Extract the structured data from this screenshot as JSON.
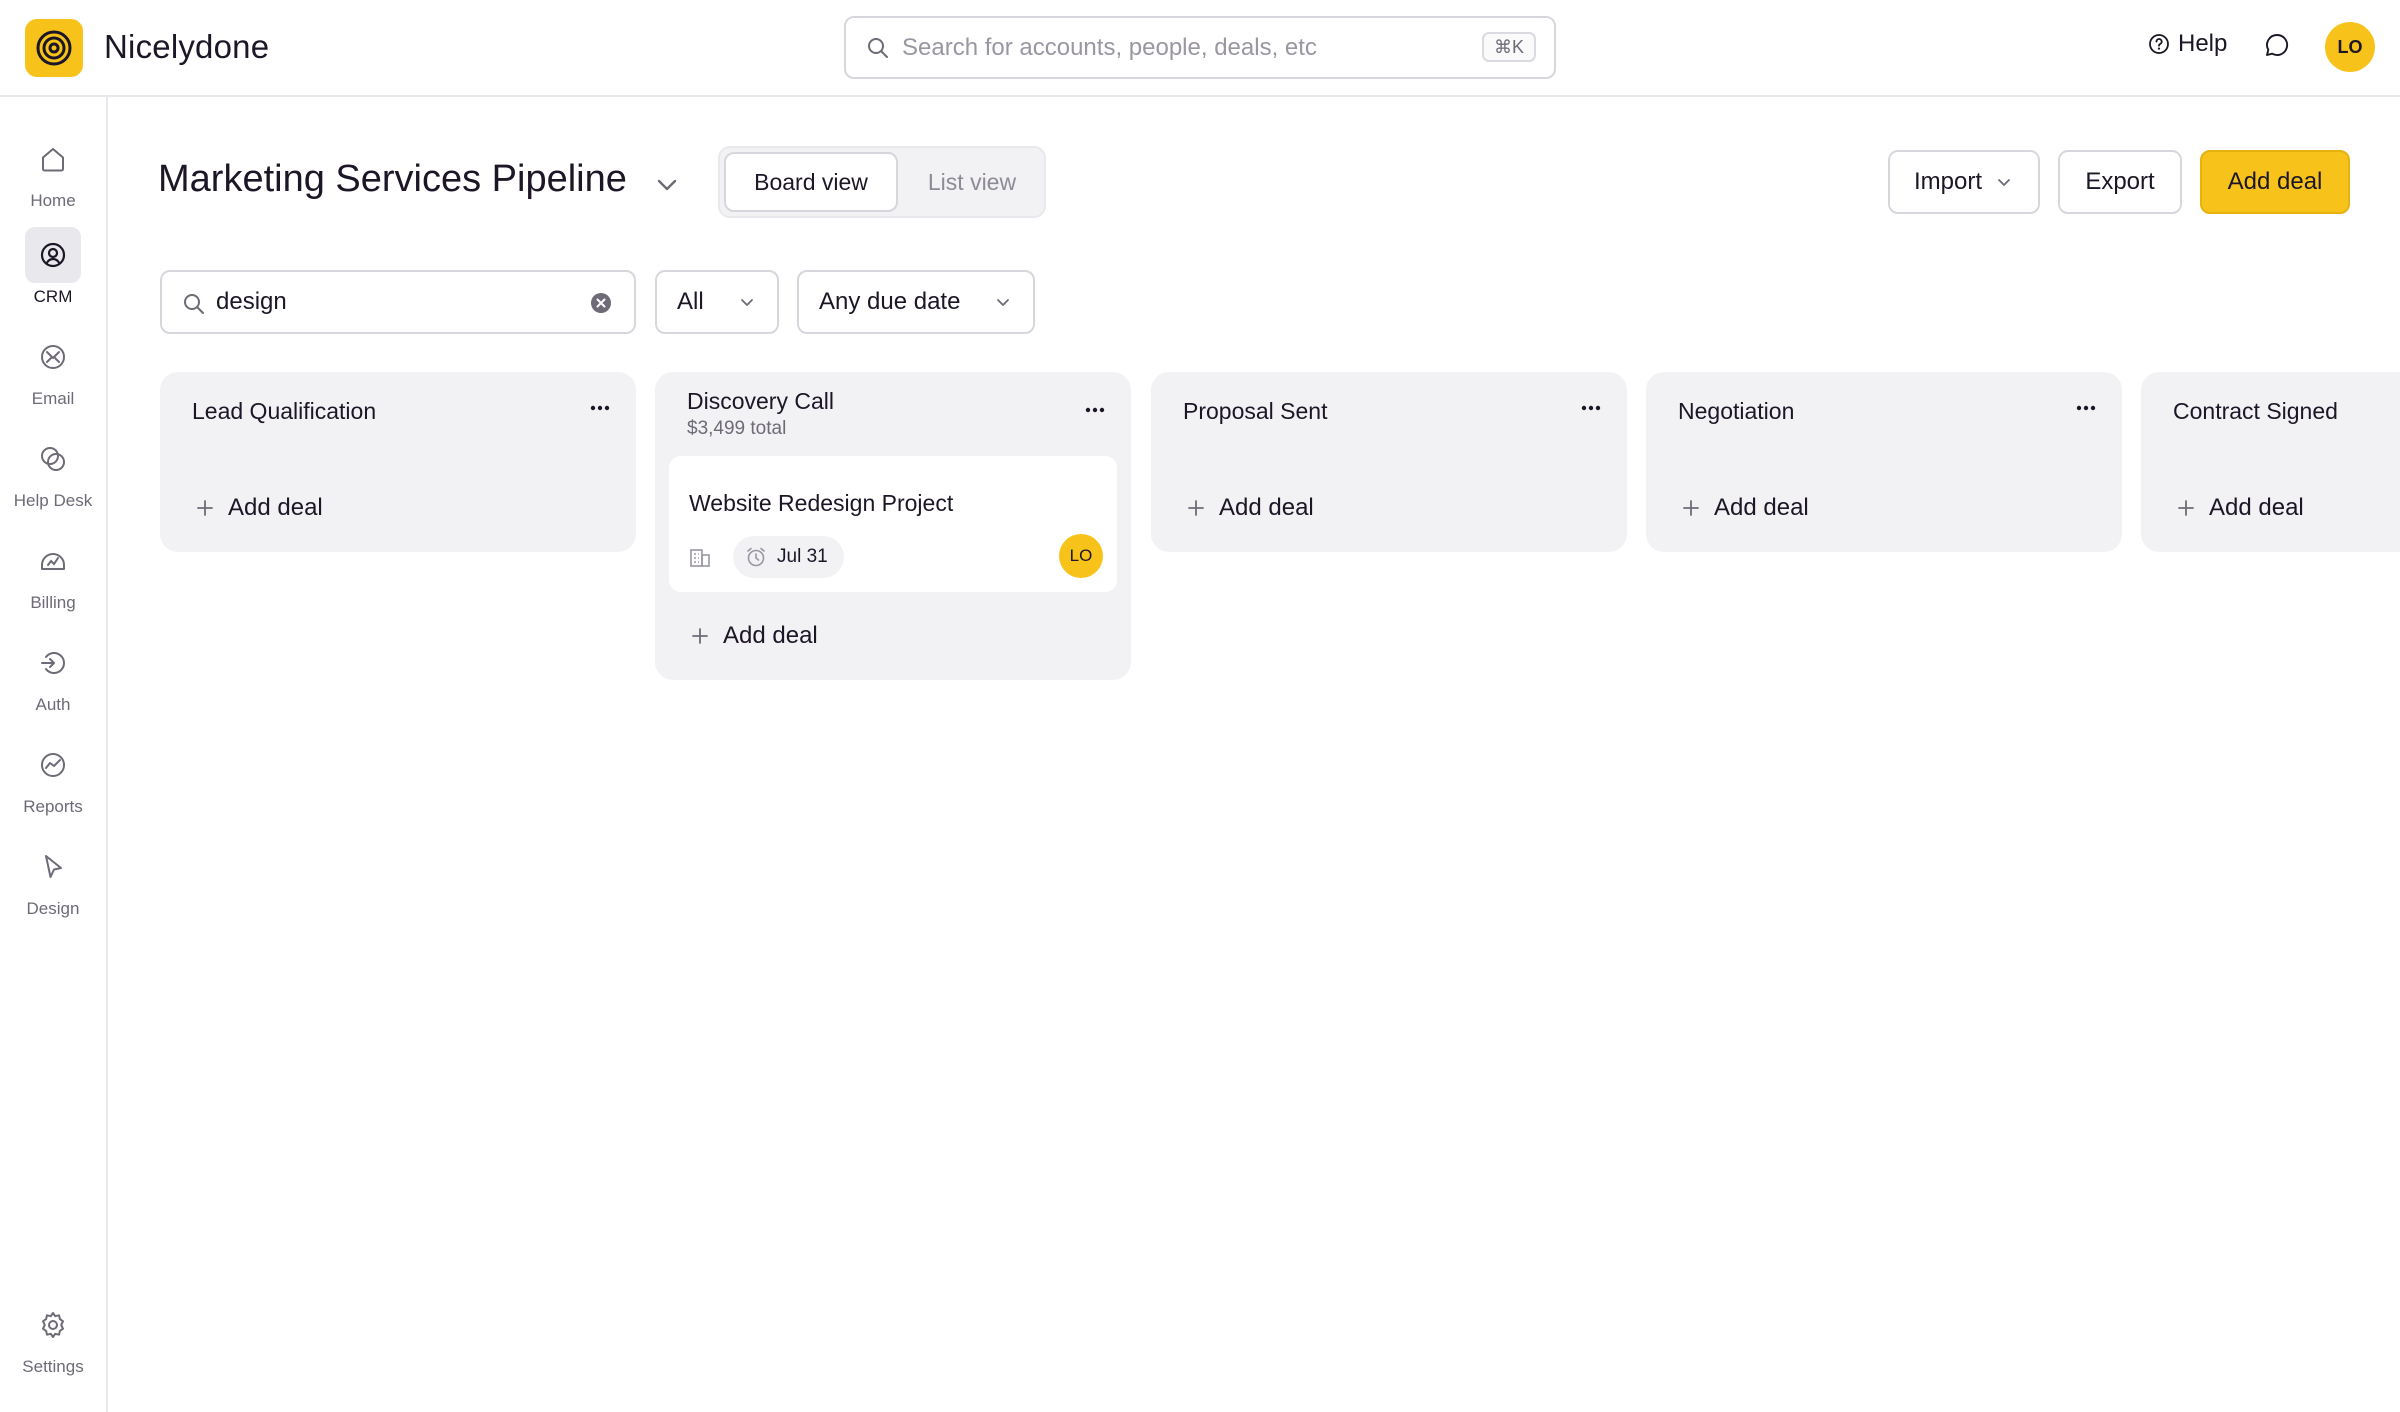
{
  "app": {
    "name": "Nicelydone",
    "search_placeholder": "Search for accounts, people, deals, etc",
    "search_shortcut": "⌘K",
    "help_label": "Help",
    "user_initials": "LO",
    "brand_color": "#f7c31b"
  },
  "sidebar": {
    "items": [
      {
        "label": "Home",
        "icon": "home-icon"
      },
      {
        "label": "CRM",
        "icon": "crm-icon",
        "active": true
      },
      {
        "label": "Email",
        "icon": "email-icon"
      },
      {
        "label": "Help Desk",
        "icon": "help-desk-icon"
      },
      {
        "label": "Billing",
        "icon": "billing-icon"
      },
      {
        "label": "Auth",
        "icon": "auth-icon"
      },
      {
        "label": "Reports",
        "icon": "reports-icon"
      },
      {
        "label": "Design",
        "icon": "design-icon"
      }
    ],
    "settings_label": "Settings"
  },
  "header": {
    "title": "Marketing Services Pipeline",
    "views": {
      "board": "Board view",
      "list": "List view",
      "active": "board"
    },
    "import_label": "Import",
    "export_label": "Export",
    "add_deal_label": "Add deal"
  },
  "filters": {
    "search_value": "design",
    "owner_filter": "All",
    "due_filter": "Any due date"
  },
  "board": {
    "add_deal_label": "Add deal",
    "columns": [
      {
        "title": "Lead Qualification",
        "total": "",
        "cards": []
      },
      {
        "title": "Discovery Call",
        "total": "$3,499 total",
        "cards": [
          {
            "title": "Website Redesign Project",
            "due": "Jul 31",
            "owner_initials": "LO"
          }
        ]
      },
      {
        "title": "Proposal Sent",
        "total": "",
        "cards": []
      },
      {
        "title": "Negotiation",
        "total": "",
        "cards": []
      },
      {
        "title": "Contract Signed",
        "total": "",
        "cards": []
      }
    ]
  }
}
